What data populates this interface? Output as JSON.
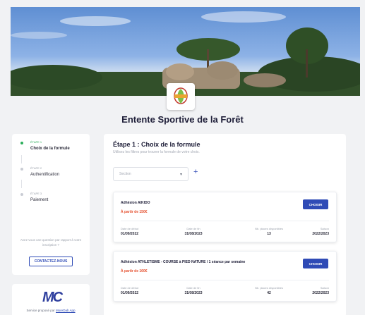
{
  "club": {
    "name": "Entente Sportive de la Forêt"
  },
  "steps": [
    {
      "eyebrow": "ÉTAPE 1",
      "label": "Choix de la formule",
      "active": true
    },
    {
      "eyebrow": "ÉTAPE 2",
      "label": "Authentification",
      "active": false
    },
    {
      "eyebrow": "ÉTAPE 3",
      "label": "Paiement",
      "active": false
    }
  ],
  "help": {
    "question": "Avez-vous une question par rapport à votre inscription ?",
    "contact_label": "CONTACTEZ-NOUS"
  },
  "powered": {
    "logo": "MC",
    "text": "Service proposé par ",
    "link": "MoreDab App"
  },
  "main": {
    "title": "Étape 1 : Choix de la formule",
    "subtitle": "Utilisez les filtres pour trouver la formule de votre choix.",
    "filter_placeholder": "Section",
    "add_symbol": "+"
  },
  "cards": [
    {
      "name": "Adhésion AIKIDO",
      "price": "À partir de 150€",
      "choose_label": "CHOISIR",
      "start_label": "Date de début",
      "start": "01/09/2022",
      "end_label": "Date de fin",
      "end": "31/08/2023",
      "places_label": "Nb. places disponibles",
      "places": "13",
      "season_label": "Saison",
      "season": "2022/2023"
    },
    {
      "name": "Adhésion ATHLETISME - COURSE à PIED NATURE / 1 séance par semaine",
      "price": "À partir de 160€",
      "choose_label": "CHOISIR",
      "start_label": "Date de début",
      "start": "01/09/2022",
      "end_label": "Date de fin",
      "end": "31/08/2023",
      "places_label": "Nb. places disponibles",
      "places": "42",
      "season_label": "Saison",
      "season": "2022/2023"
    }
  ],
  "colors": {
    "accent": "#2f4bb6",
    "price": "#e5502f",
    "active_step": "#2cae5b"
  }
}
